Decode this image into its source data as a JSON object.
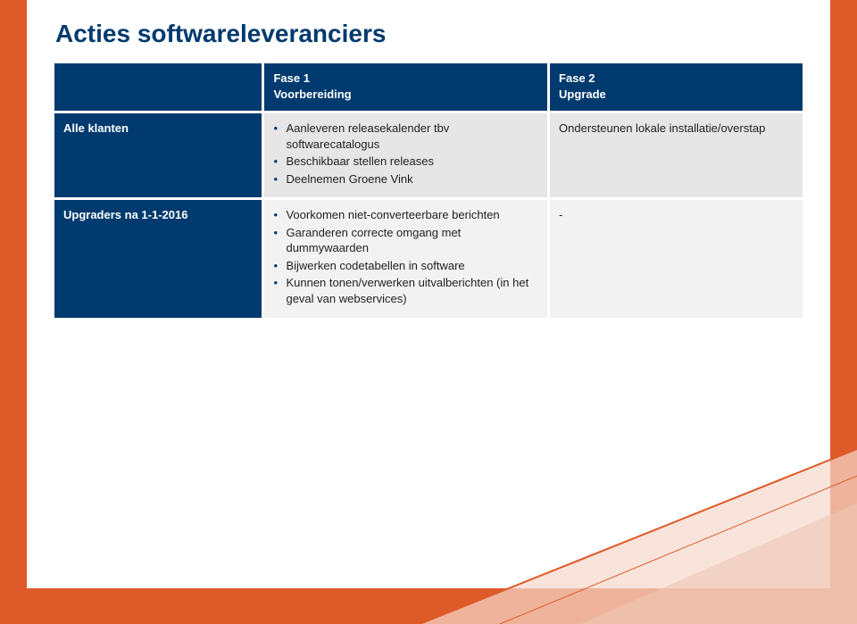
{
  "title": "Acties softwareleveranciers",
  "headers": {
    "blank": "",
    "fase1": "Fase 1\nVoorbereiding",
    "fase2": "Fase 2\nUpgrade"
  },
  "rows": [
    {
      "label": "Alle klanten",
      "fase1": [
        "Aanleveren releasekalender tbv softwarecatalogus",
        "Beschikbaar stellen releases",
        "Deelnemen Groene Vink"
      ],
      "fase2_text": "Ondersteunen lokale installatie/overstap"
    },
    {
      "label": "Upgraders na 1-1-2016",
      "fase1": [
        "Voorkomen niet-converteerbare berichten",
        "Garanderen correcte omgang met dummywaarden",
        "Bijwerken codetabellen in software",
        "Kunnen tonen/verwerken uitvalberichten (in het geval van webservices)"
      ],
      "fase2_text": "-"
    }
  ]
}
